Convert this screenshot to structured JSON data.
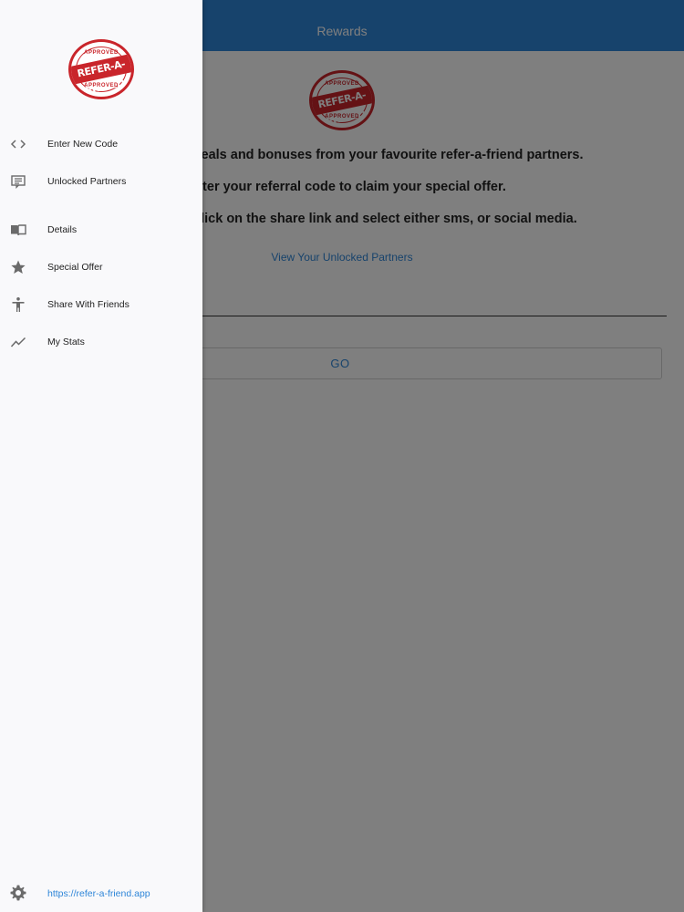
{
  "header": {
    "title": "Rewards"
  },
  "logo": {
    "top_text": "APPROVED",
    "banner_text": "REFER-A-FRIEND",
    "bottom_text": "APPROVED"
  },
  "main": {
    "line1": "eals and bonuses from your favourite refer-a-friend partners.",
    "line2": "enter your referral code to claim your special offer.",
    "line3": "ds, just click on the share link and select either sms, or social media.",
    "unlocked_link": "View Your Unlocked Partners",
    "code_input_value": "",
    "go_button": "GO"
  },
  "drawer": {
    "items": [
      {
        "label": "Enter New Code",
        "icon": "code-brackets-icon"
      },
      {
        "label": "Unlocked Partners",
        "icon": "message-list-icon"
      },
      {
        "label": "Details",
        "icon": "book-icon"
      },
      {
        "label": "Special Offer",
        "icon": "star-icon"
      },
      {
        "label": "Share With Friends",
        "icon": "person-icon"
      },
      {
        "label": "My Stats",
        "icon": "trending-line-icon"
      }
    ],
    "footer": {
      "url": "https://refer-a-friend.app",
      "icon": "gear-icon"
    }
  },
  "colors": {
    "accent": "#2f86d8",
    "stamp_red": "#c9252b",
    "drawer_bg": "#f9f9fb"
  }
}
